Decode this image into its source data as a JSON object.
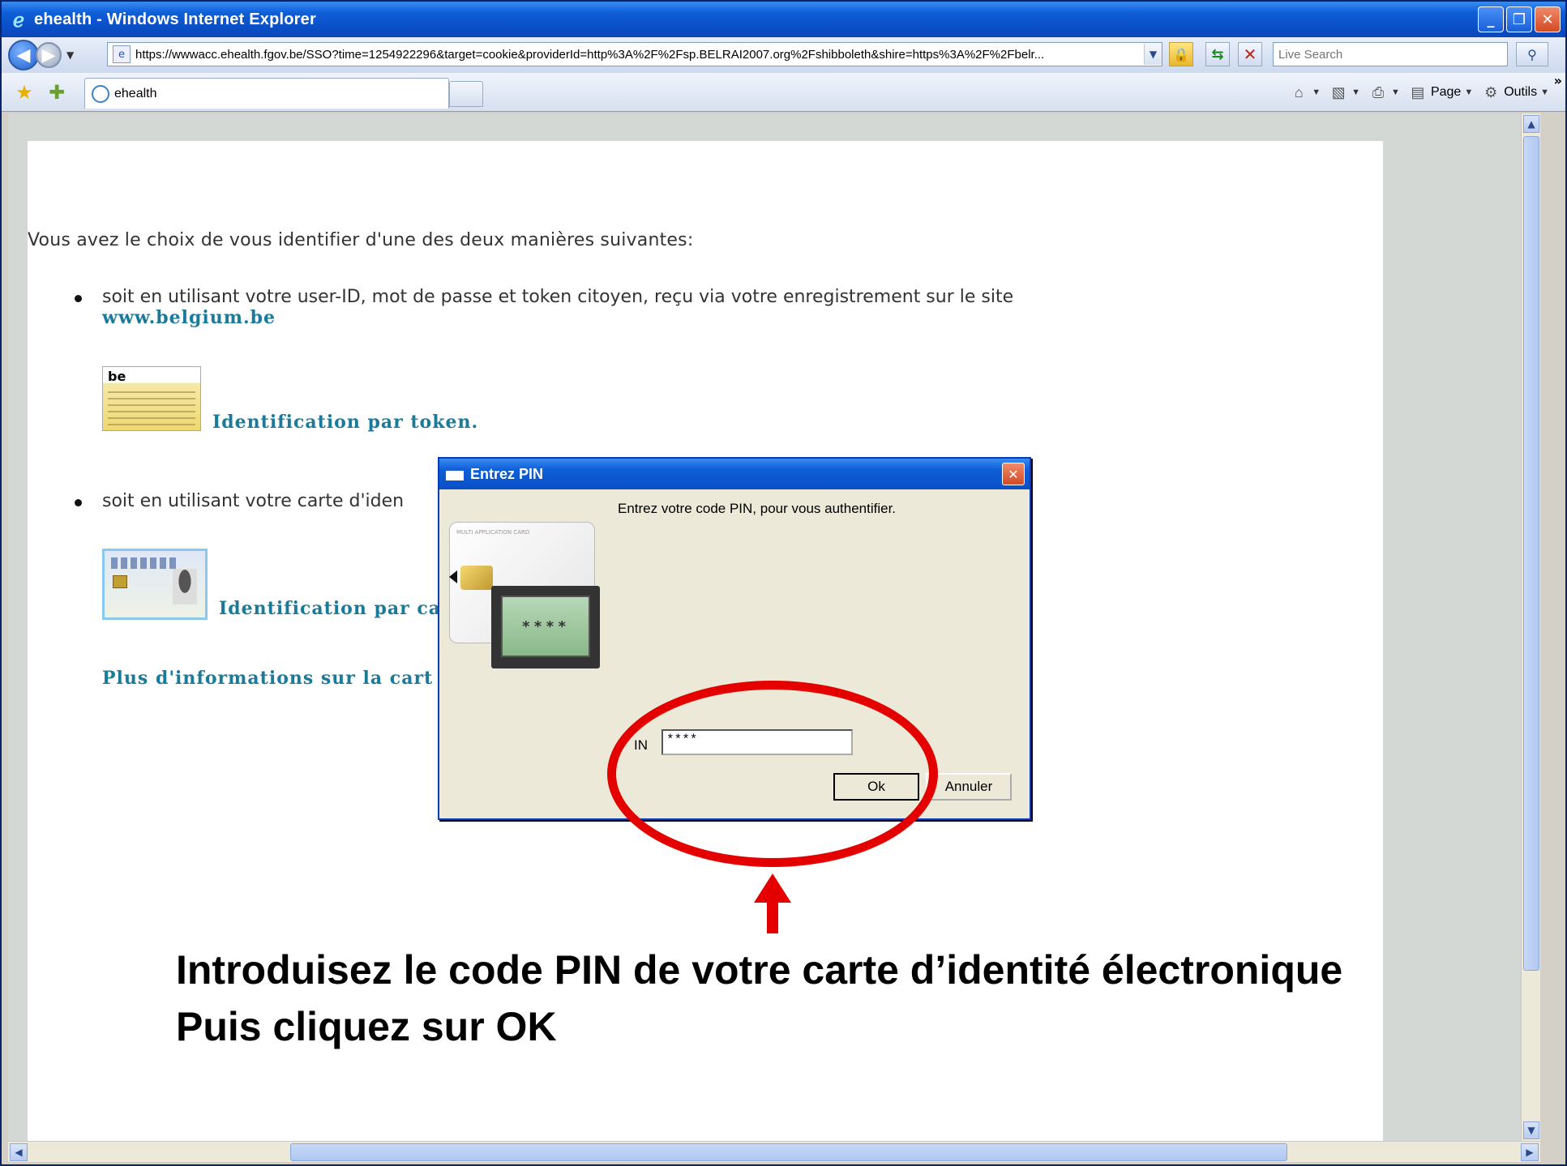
{
  "window": {
    "title": "ehealth - Windows Internet Explorer",
    "controls": {
      "minimize": "_",
      "restore": "❐",
      "close": "✕"
    }
  },
  "navbar": {
    "url": "https://wwwacc.ehealth.fgov.be/SSO?time=1254922296&target=cookie&providerId=http%3A%2F%2Fsp.BELRAI2007.org%2Fshibboleth&shire=https%3A%2F%2Fbelr...",
    "search_placeholder": "Live Search"
  },
  "tabs": [
    {
      "label": "ehealth"
    }
  ],
  "commandbar": {
    "page_label": "Page",
    "tools_label": "Outils"
  },
  "page": {
    "intro": "Vous avez le choix de vous identifier d'une des deux manières suivantes:",
    "bullet1_text": "soit en utilisant votre user-ID, mot de passe et token citoyen, reçu via votre enregistrement sur le site",
    "bullet1_link": "www.belgium.be",
    "token_link": "Identification par token.",
    "token_image_text": "be",
    "bullet2_text": "soit en utilisant votre carte d'iden",
    "eid_link": "Identification par ca",
    "more_info_link": "Plus d'informations sur la cart"
  },
  "dialog": {
    "title": "Entrez PIN",
    "message": "Entrez votre code PIN, pour vous authentifier.",
    "card_header": "MULTI APPLICATION CARD",
    "reader_display": "****",
    "pin_label": "IN",
    "pin_value": "****",
    "ok_label": "Ok",
    "cancel_label": "Annuler"
  },
  "annotation": {
    "line1": "Introduisez le code PIN de votre carte d’identité électronique",
    "line2": "Puis cliquez sur OK",
    "color": "#e50000"
  }
}
